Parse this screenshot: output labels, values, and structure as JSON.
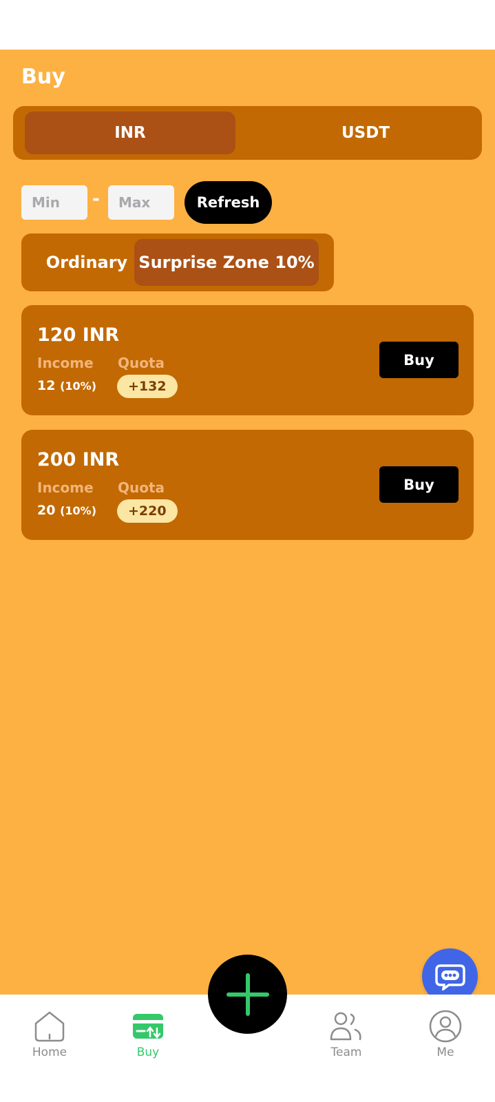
{
  "header": {
    "title": "Buy"
  },
  "currency_tabs": [
    {
      "label": "INR",
      "active": true
    },
    {
      "label": "USDT",
      "active": false
    }
  ],
  "filter": {
    "min_placeholder": "Min",
    "max_placeholder": "Max",
    "separator": "-",
    "refresh_label": "Refresh"
  },
  "zone_tabs": [
    {
      "label": "Ordinary",
      "active": false
    },
    {
      "label": "Surprise Zone 10%",
      "active": true
    }
  ],
  "offers": [
    {
      "amount": "120 INR",
      "income_label": "Income",
      "quota_label": "Quota",
      "income": "12",
      "income_pct": "(10%)",
      "quota": "+132",
      "buy_label": "Buy"
    },
    {
      "amount": "200 INR",
      "income_label": "Income",
      "quota_label": "Quota",
      "income": "20",
      "income_pct": "(10%)",
      "quota": "+220",
      "buy_label": "Buy"
    }
  ],
  "bottom_nav": [
    {
      "label": "Home",
      "icon": "home-icon",
      "active": false
    },
    {
      "label": "Buy",
      "icon": "buy-icon",
      "active": true
    },
    {
      "label": "Team",
      "icon": "team-icon",
      "active": false
    },
    {
      "label": "Me",
      "icon": "profile-icon",
      "active": false
    }
  ],
  "colors": {
    "background": "#fdb142",
    "panel": "#c26903",
    "active_tab": "#ab5116",
    "button": "#000000",
    "quota_badge": "#fbe6a3",
    "nav_active": "#35c86a",
    "chat_fab": "#4065e6"
  }
}
